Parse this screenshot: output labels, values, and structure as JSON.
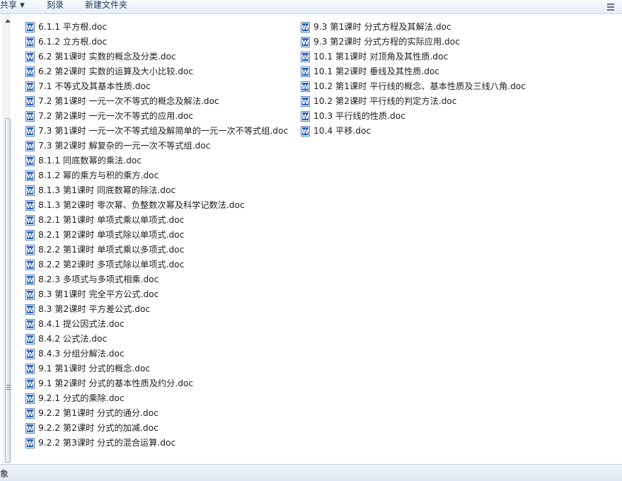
{
  "toolbar": {
    "share_label": "共享",
    "burn_label": "刻录",
    "new_folder_label": "新建文件夹"
  },
  "files": {
    "column1": [
      "6.1.1 平方根.doc",
      "6.1.2 立方根.doc",
      "6.2 第1课时 实数的概念及分类.doc",
      "6.2 第2课时  实数的运算及大小比较.doc",
      "7.1 不等式及其基本性质.doc",
      "7.2 第1课时 一元一次不等式的概念及解法.doc",
      "7.2 第2课时 一元一次不等式的应用.doc",
      "7.3 第1课时  一元一次不等式组及解简单的一元一次不等式组.doc",
      "7.3 第2课时 解复杂的一元一次不等式组.doc",
      "8.1.1 同底数幂的乘法.doc",
      "8.1.2 幂的乘方与积的乘方.doc",
      "8.1.3 第1课时 同底数幂的除法.doc",
      "8.1.3 第2课时 零次幂、负整数次幂及科学记数法.doc",
      "8.2.1 第1课时 单项式乘以单项式.doc",
      "8.2.1 第2课时 单项式除以单项式.doc",
      "8.2.2 第1课时 单项式乘以多项式.doc",
      "8.2.2 第2课时 多项式除以单项式.doc",
      "8.2.3 多项式与多项式相乘.doc",
      "8.3 第1课时 完全平方公式.doc",
      "8.3 第2课时 平方差公式.doc",
      "8.4.1 提公因式法.doc",
      "8.4.2 公式法.doc",
      "8.4.3 分组分解法.doc",
      "9.1 第1课时 分式的概念.doc",
      "9.1 第2课时 分式的基本性质及约分.doc",
      "9.2.1 分式的乘除.doc",
      "9.2.2 第1课时 分式的通分.doc",
      "9.2.2 第2课时 分式的加减.doc",
      "9.2.2 第3课时 分式的混合运算.doc"
    ],
    "column2": [
      "9.3 第1课时 分式方程及其解法.doc",
      "9.3 第2课时 分式方程的实际应用.doc",
      "10.1 第1课时 对顶角及其性质.doc",
      "10.1 第2课时 垂线及其性质.doc",
      "10.2 第1课时 平行线的概念、基本性质及三线八角.doc",
      "10.2 第2课时 平行线的判定方法.doc",
      "10.3 平行线的性质.doc",
      "10.4 平移.doc"
    ]
  },
  "status": {
    "text": "象"
  },
  "icons": {
    "file_icon": "word-document-icon",
    "view_icon": "view-options-icon",
    "accent": "#2b5fb4"
  }
}
